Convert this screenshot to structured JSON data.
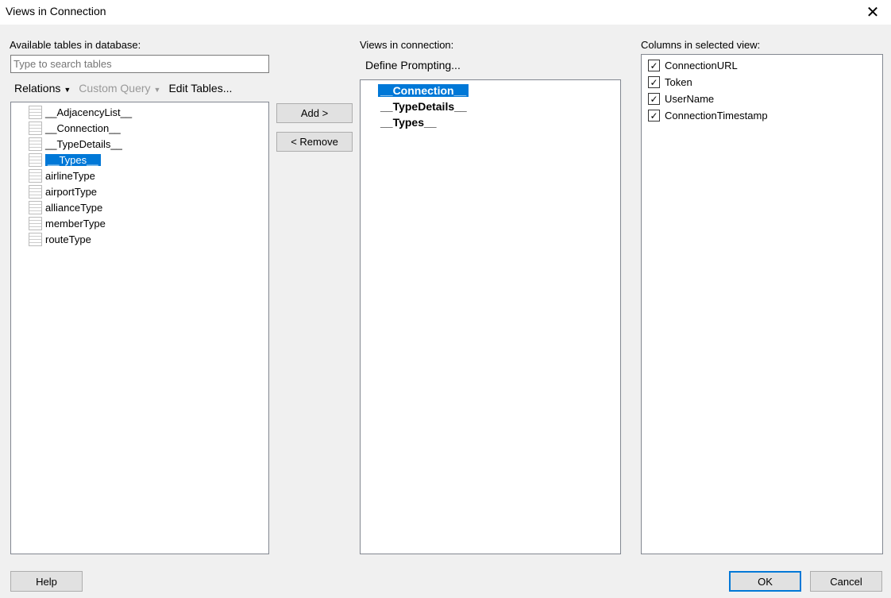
{
  "window": {
    "title": "Views in Connection"
  },
  "left": {
    "label": "Available tables in database:",
    "search_placeholder": "Type to search tables",
    "relations": "Relations",
    "custom_query": "Custom Query",
    "edit_tables": "Edit Tables...",
    "tables": [
      "__AdjacencyList__",
      "__Connection__",
      "__TypeDetails__",
      "__Types__",
      "airlineType",
      "airportType",
      "allianceType",
      "memberType",
      "routeType"
    ],
    "selected_index": 3
  },
  "middle": {
    "add": "Add >",
    "remove": "< Remove"
  },
  "views": {
    "label": "Views in connection:",
    "define_prompting": "Define Prompting...",
    "items": [
      "__Connection__",
      "__TypeDetails__",
      "__Types__"
    ],
    "selected_index": 0
  },
  "columns": {
    "label": "Columns in selected view:",
    "items": [
      {
        "name": "ConnectionURL",
        "checked": true
      },
      {
        "name": "Token",
        "checked": true
      },
      {
        "name": "UserName",
        "checked": true
      },
      {
        "name": "ConnectionTimestamp",
        "checked": true
      }
    ]
  },
  "footer": {
    "help": "Help",
    "ok": "OK",
    "cancel": "Cancel"
  }
}
